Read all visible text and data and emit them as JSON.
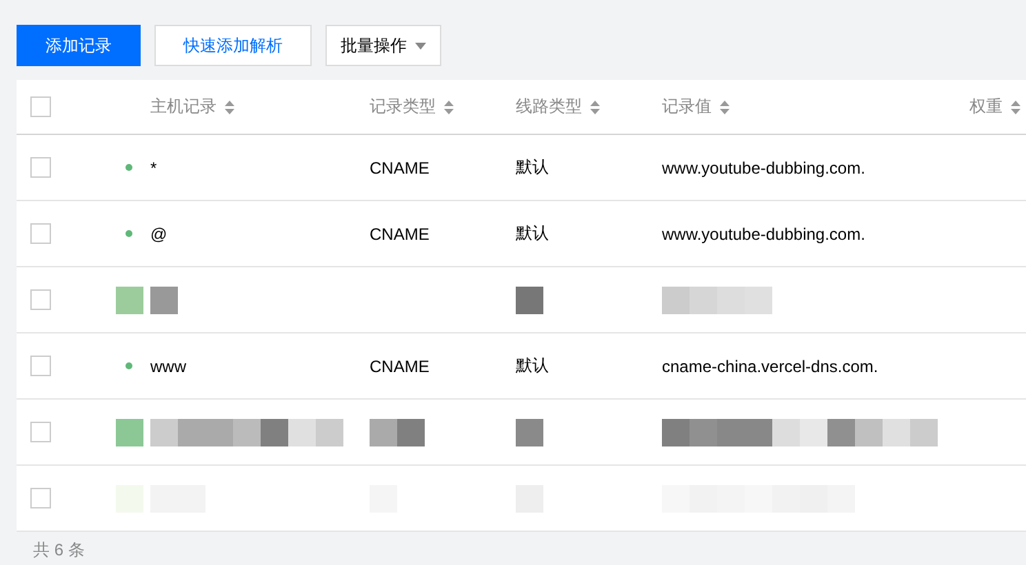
{
  "toolbar": {
    "buttons": [
      {
        "label": "添加记录",
        "kind": "primary"
      },
      {
        "label": "快速添加解析",
        "kind": "secondary"
      },
      {
        "label": "批量操作",
        "kind": "dropdown"
      }
    ]
  },
  "table": {
    "columns": [
      {
        "label": "主机记录",
        "sortable": true
      },
      {
        "label": "记录类型",
        "sortable": true
      },
      {
        "label": "线路类型",
        "sortable": true
      },
      {
        "label": "记录值",
        "sortable": true
      },
      {
        "label": "权重",
        "sortable": true
      }
    ],
    "header_checked": false,
    "rows": [
      {
        "kind": "record",
        "checked": false,
        "host": "*",
        "type": "CNAME",
        "line": "默认",
        "value": "www.youtube-dubbing.com."
      },
      {
        "kind": "record",
        "checked": false,
        "host": "@",
        "type": "CNAME",
        "line": "默认",
        "value": "www.youtube-dubbing.com."
      },
      {
        "kind": "redacted",
        "checked": false
      },
      {
        "kind": "record",
        "checked": false,
        "host": "www",
        "type": "CNAME",
        "line": "默认",
        "value": "cname-china.vercel-dns.com."
      },
      {
        "kind": "redacted",
        "checked": false
      },
      {
        "kind": "redacted",
        "checked": false
      }
    ]
  },
  "footer": {
    "total": "共 6 条"
  }
}
